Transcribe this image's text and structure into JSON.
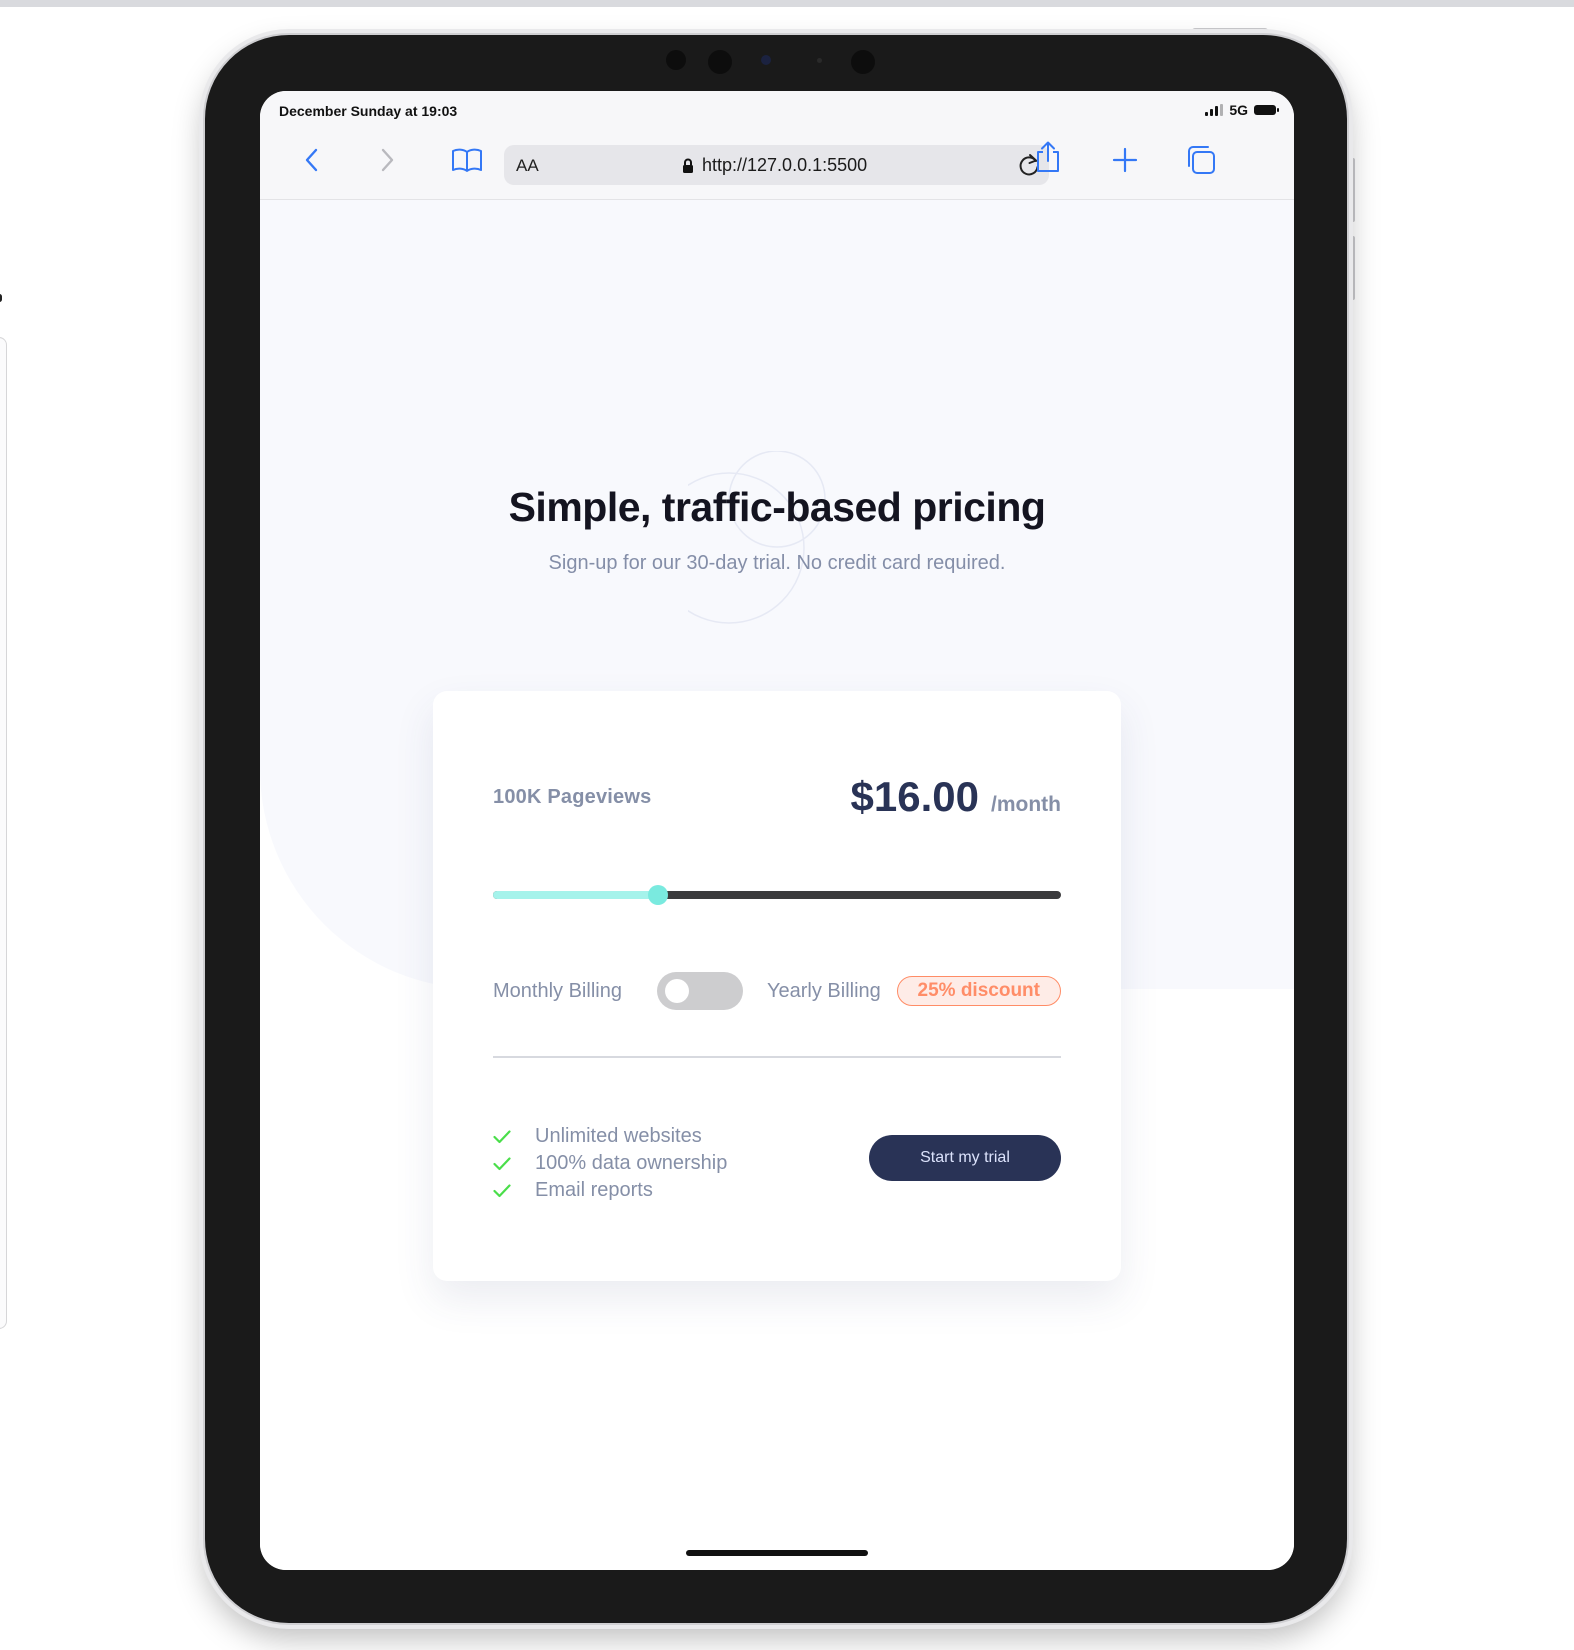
{
  "status_bar": {
    "time": "December Sunday at 19:03",
    "network": "5G"
  },
  "browser": {
    "text_size_label": "AA",
    "url": "http://127.0.0.1:5500",
    "icons": [
      "back-icon",
      "forward-icon",
      "bookmarks-icon",
      "lock-icon",
      "reload-icon",
      "share-icon",
      "new-tab-icon",
      "tabs-icon"
    ]
  },
  "hero": {
    "title": "Simple, traffic-based pricing",
    "subtitle": "Sign-up for our 30-day trial. No credit card required."
  },
  "pricing": {
    "pageviews": "100K Pageviews",
    "price": "$16.00",
    "period": "/month",
    "slider_fraction": 0.29,
    "billing_monthly": "Monthly Billing",
    "billing_yearly": "Yearly Billing",
    "discount": "25% discount",
    "yearly_selected": false
  },
  "features": [
    "Unlimited websites",
    "100% data ownership",
    "Email reports"
  ],
  "cta": "Start my trial",
  "colors": {
    "accent_dark": "#293356",
    "slider_fill": "#a5f3eb",
    "slider_knob": "#7aeadf",
    "discount": "#ff8d68",
    "check": "#4ade4a",
    "ios_blue": "#3478f6"
  }
}
